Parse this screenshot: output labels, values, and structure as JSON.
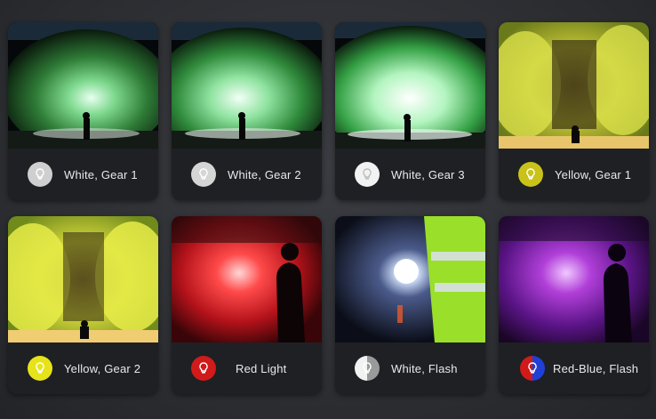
{
  "modes": [
    {
      "label": "White, Gear 1",
      "icon": "white-bulb-icon",
      "icon_color": "#cfcfcf"
    },
    {
      "label": "White, Gear 2",
      "icon": "white-bulb-icon",
      "icon_color": "#d5d5d5"
    },
    {
      "label": "White, Gear 3",
      "icon": "white-bulb-icon",
      "icon_color": "#f2f2f2"
    },
    {
      "label": "Yellow, Gear 1",
      "icon": "yellow-bulb-icon",
      "icon_color": "#c8c21a"
    },
    {
      "label": "Yellow, Gear 2",
      "icon": "yellow-bulb-icon",
      "icon_color": "#e6e31a"
    },
    {
      "label": "Red Light",
      "icon": "red-bulb-icon",
      "icon_color": "#d11a1a"
    },
    {
      "label": "White, Flash",
      "icon": "white-flash-bulb-icon",
      "icon_color": "#bdbdbd"
    },
    {
      "label": "Red-Blue, Flash",
      "icon": "red-blue-flash-bulb-icon",
      "icon_color": "#1f3fd6"
    }
  ]
}
